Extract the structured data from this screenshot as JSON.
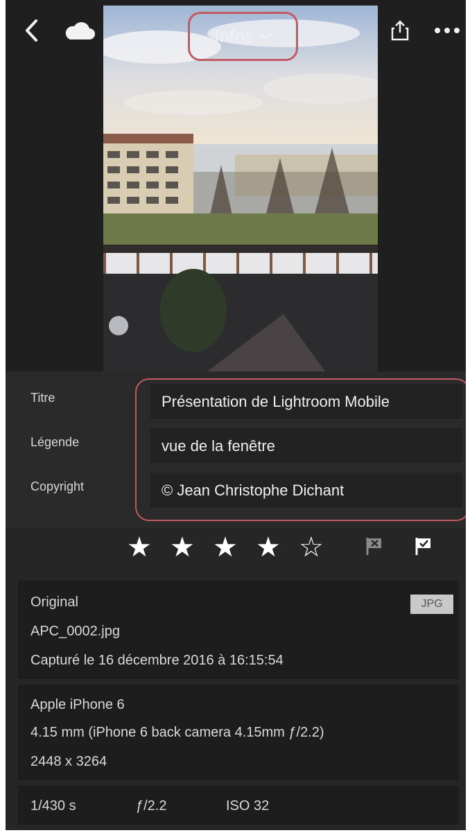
{
  "header": {
    "title": "Infos",
    "back_icon": "chevron-left-icon",
    "cloud_icon": "cloud-icon",
    "share_icon": "share-icon",
    "more_icon": "more-horizontal-icon",
    "accent_color": "#c25a61"
  },
  "metadata": {
    "title_label": "Titre",
    "title_value": "Présentation de Lightroom Mobile",
    "caption_label": "Légende",
    "caption_value": "vue de la fenêtre",
    "copyright_label": "Copyright",
    "copyright_value": "© Jean Christophe Dichant"
  },
  "rating": {
    "stars": 4,
    "max": 5,
    "reject_flag_icon": "reject-flag-icon",
    "pick_flag_icon": "pick-flag-icon"
  },
  "file": {
    "original_label": "Original",
    "format": "JPG",
    "filename": "APC_0002.jpg",
    "captured": "Capturé le 16 décembre 2016 à 16:15:54"
  },
  "camera": {
    "model": "Apple iPhone 6",
    "lens": "4.15 mm (iPhone 6 back camera 4.15mm ƒ/2.2)",
    "dimensions": "2448 x 3264"
  },
  "exposure": {
    "shutter": "1/430 s",
    "aperture": "ƒ/2.2",
    "iso": "ISO 32"
  }
}
